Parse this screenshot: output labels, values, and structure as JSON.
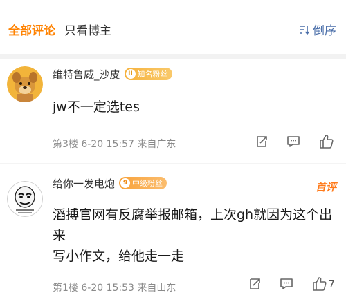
{
  "tabs": {
    "all": "全部评论",
    "owner_only": "只看博主",
    "sort": "倒序"
  },
  "comments": [
    {
      "user": "维特鲁威_沙皮",
      "badge": "知名粉丝",
      "badge_mark": "II",
      "text": "jw不一定选tes",
      "meta": "第3楼 6-20 15:57 来自广东",
      "likes": ""
    },
    {
      "user": "给你一发电炮",
      "badge": "中级粉丝",
      "badge_mark": "9",
      "tag": "首评",
      "text_line1": "滔搏官网有反腐举报邮箱，上次gh就因为这个出来",
      "text_line2": "写小作文，给他走一走",
      "meta": "第1楼 6-20 15:53 来自山东",
      "likes": "7"
    }
  ],
  "colors": {
    "accent": "#ff8200",
    "link": "#4a6ea9",
    "hot": "#ff7a1a"
  }
}
